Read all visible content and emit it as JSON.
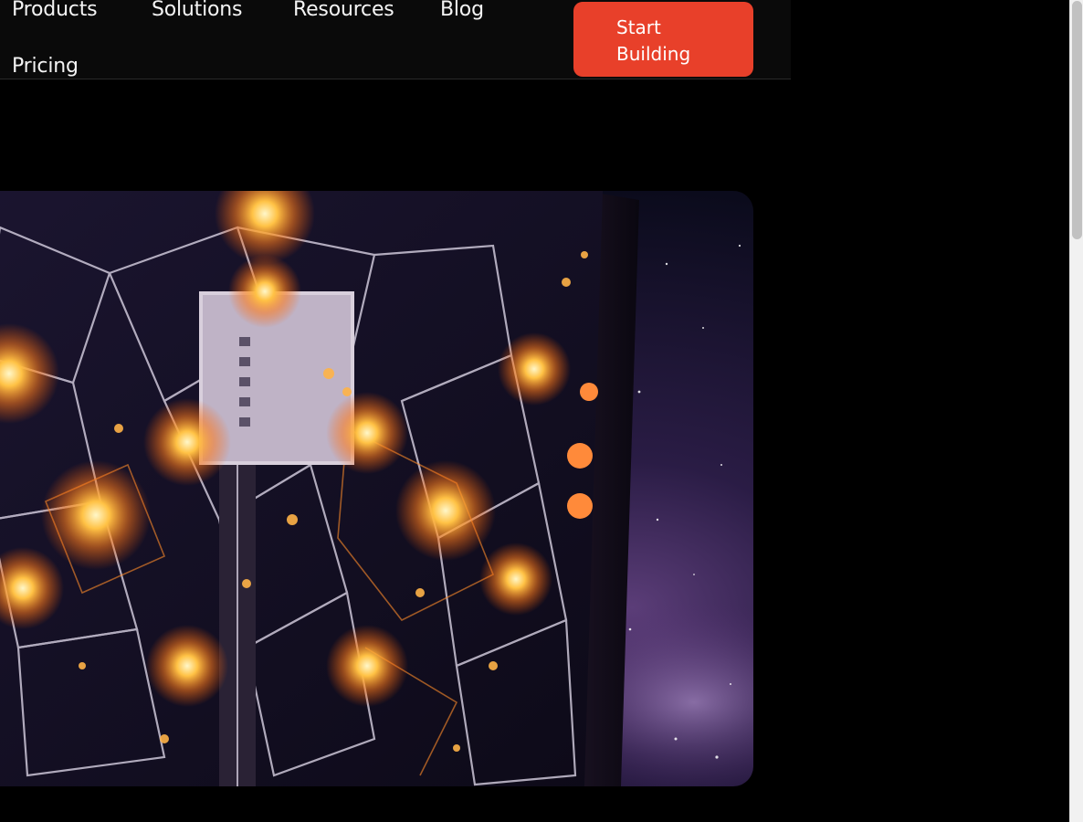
{
  "nav": {
    "items": [
      {
        "label": "Products"
      },
      {
        "label": "Solutions"
      },
      {
        "label": "Resources"
      },
      {
        "label": "Blog"
      },
      {
        "label": "Pricing"
      }
    ],
    "cta": {
      "line1": "Start",
      "line2": "Building"
    }
  },
  "colors": {
    "accent": "#e8402a",
    "background": "#000000",
    "nav_background": "#0a0a0a"
  },
  "hero": {
    "image": "glowing-cosmic-cube-illustration"
  }
}
